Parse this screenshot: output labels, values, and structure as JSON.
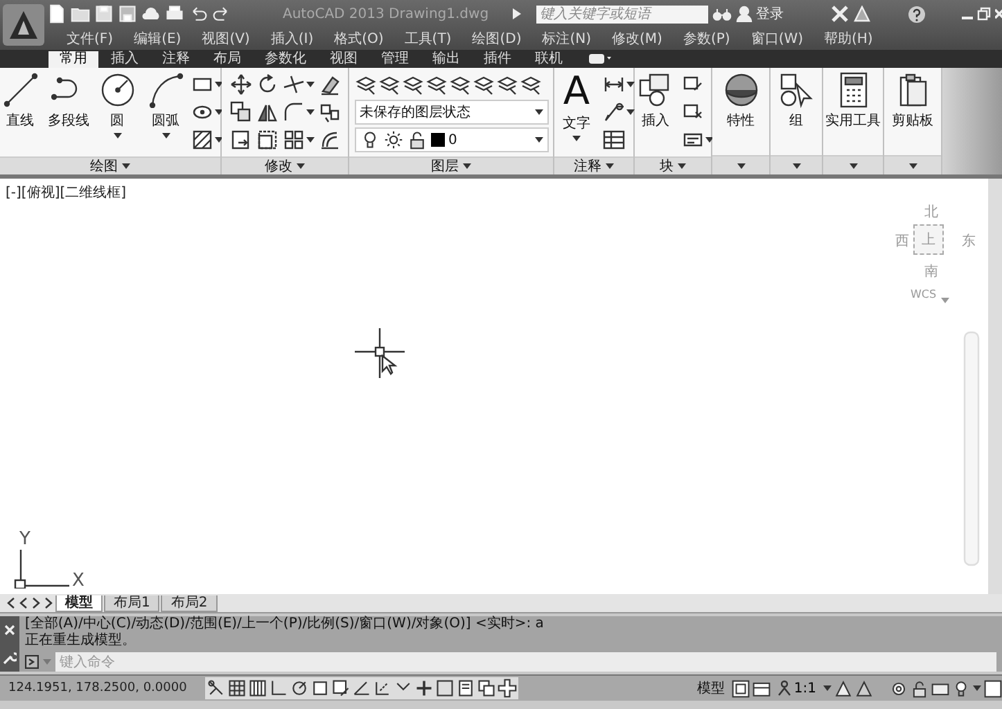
{
  "title_bar": {
    "title": "AutoCAD 2013   Drawing1.dwg",
    "search": {
      "placeholder": "键入关键字或短语"
    },
    "user": "登录"
  },
  "menu": [
    "文件(F)",
    "编辑(E)",
    "视图(V)",
    "插入(I)",
    "格式(O)",
    "工具(T)",
    "绘图(D)",
    "标注(N)",
    "修改(M)",
    "参数(P)",
    "窗口(W)",
    "帮助(H)"
  ],
  "ribbon_tabs": [
    {
      "label": "常用",
      "selected": true
    },
    {
      "label": "插入",
      "selected": false
    },
    {
      "label": "注释",
      "selected": false
    },
    {
      "label": "布局",
      "selected": false
    },
    {
      "label": "参数化",
      "selected": false
    },
    {
      "label": "视图",
      "selected": false
    },
    {
      "label": "管理",
      "selected": false
    },
    {
      "label": "输出",
      "selected": false
    },
    {
      "label": "插件",
      "selected": false
    },
    {
      "label": "联机",
      "selected": false
    }
  ],
  "panels": [
    {
      "kind": "draw",
      "title": "绘图",
      "tools": [
        "直线",
        "多段线",
        "圆",
        "圆弧"
      ]
    },
    {
      "kind": "modify",
      "title": "修改"
    },
    {
      "kind": "layers",
      "title": "图层",
      "layer_state": "未保存的图层状态",
      "current_layer": "0"
    },
    {
      "kind": "annotation",
      "title": "注释",
      "glyph": "A",
      "tool": "文字"
    },
    {
      "kind": "block",
      "title": "块",
      "tool": "插入"
    },
    {
      "kind": "properties",
      "tool": "特性"
    },
    {
      "kind": "group",
      "tool": "组"
    },
    {
      "kind": "utilities",
      "tool": "实用工具"
    },
    {
      "kind": "clipboard",
      "tool": "剪贴板"
    }
  ],
  "viewport": {
    "label": "[-][俯视][二维线框]",
    "viewcube": {
      "north": "北",
      "west": "西",
      "top": "上",
      "east": "东",
      "south": "南",
      "ucs": "WCS"
    },
    "ucs_axes": {
      "y": "Y",
      "x": "X"
    }
  },
  "layout_tabs": [
    {
      "label": "模型",
      "selected": true
    },
    {
      "label": "布局1",
      "selected": false
    },
    {
      "label": "布局2",
      "selected": false
    }
  ],
  "command_line": {
    "history": [
      "[全部(A)/中心(C)/动态(D)/范围(E)/上一个(P)/比例(S)/窗口(W)/对象(O)] <实时>: a",
      "正在重生成模型。"
    ],
    "placeholder": "键入命令"
  },
  "status_bar": {
    "coordinates": "124.1951, 178.2500, 0.0000",
    "space": "模型",
    "annotation_scale": "1:1"
  }
}
